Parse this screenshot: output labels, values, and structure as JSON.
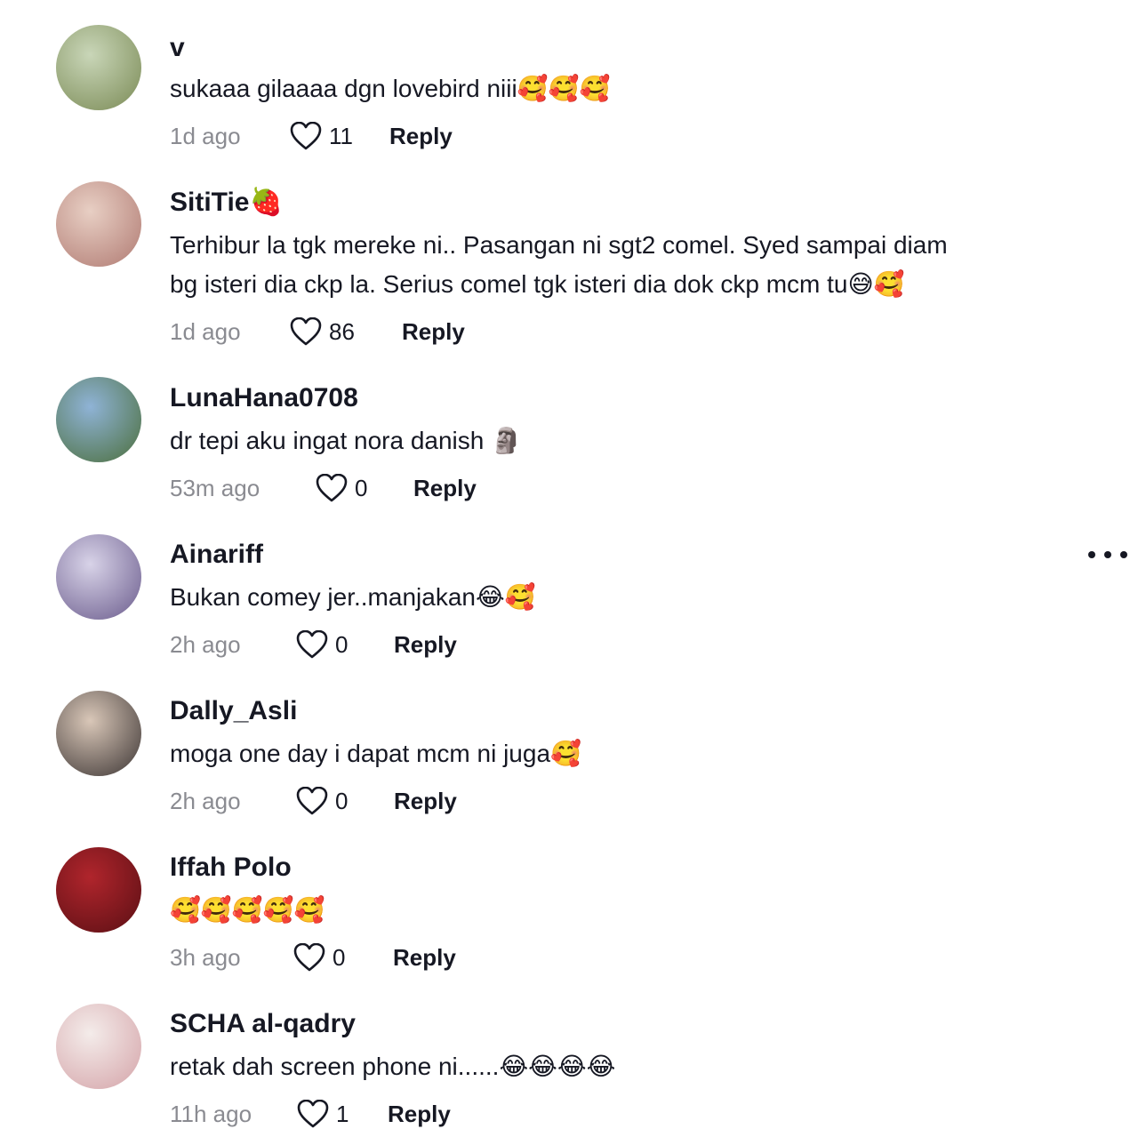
{
  "comments": [
    {
      "username": "v",
      "text_lines": [
        "sukaaa gilaaaa dgn lovebird niii🥰🥰🥰"
      ],
      "time": "1d ago",
      "likes": "11",
      "reply_label": "Reply",
      "avatar_colors": [
        "#c9d6b8",
        "#7a8a55"
      ]
    },
    {
      "username": "SitiTie🍓",
      "text_lines": [
        "Terhibur la tgk mereke ni.. Pasangan ni sgt2 comel. Syed sampai diam",
        "bg isteri dia ckp la. Serius comel tgk isteri dia dok ckp mcm tu😅🥰"
      ],
      "time": "1d ago",
      "likes": "86",
      "reply_label": "Reply",
      "avatar_colors": [
        "#e8cfc4",
        "#b07a72"
      ]
    },
    {
      "username": "LunaHana0708",
      "text_lines": [
        "dr tepi aku ingat nora danish 🗿"
      ],
      "time": "53m ago",
      "likes": "0",
      "reply_label": "Reply",
      "avatar_colors": [
        "#8fb3d6",
        "#4b6e3b"
      ]
    },
    {
      "username": "Ainariff",
      "text_lines": [
        "Bukan comey jer..manjakan😂🥰"
      ],
      "time": "2h ago",
      "likes": "0",
      "reply_label": "Reply",
      "avatar_colors": [
        "#d8d3e8",
        "#6a5b8c"
      ]
    },
    {
      "username": "Dally_Asli",
      "text_lines": [
        "moga one day i dapat mcm ni juga🥰"
      ],
      "time": "2h ago",
      "likes": "0",
      "reply_label": "Reply",
      "avatar_colors": [
        "#d9c7b8",
        "#3b3433"
      ]
    },
    {
      "username": "Iffah Polo",
      "text_lines": [
        "🥰🥰🥰🥰🥰"
      ],
      "time": "3h ago",
      "likes": "0",
      "reply_label": "Reply",
      "avatar_colors": [
        "#b0252c",
        "#5a0f14"
      ]
    },
    {
      "username": "SCHA al-qadry",
      "text_lines": [
        "retak dah screen phone ni......😂😂😂😂"
      ],
      "time": "11h ago",
      "likes": "1",
      "reply_label": "Reply",
      "avatar_colors": [
        "#f4ecea",
        "#d4a3a8"
      ]
    }
  ],
  "more_icon": "ellipsis-icon",
  "colors": {
    "text": "#161823",
    "meta": "#8a8b91",
    "background": "#ffffff"
  }
}
